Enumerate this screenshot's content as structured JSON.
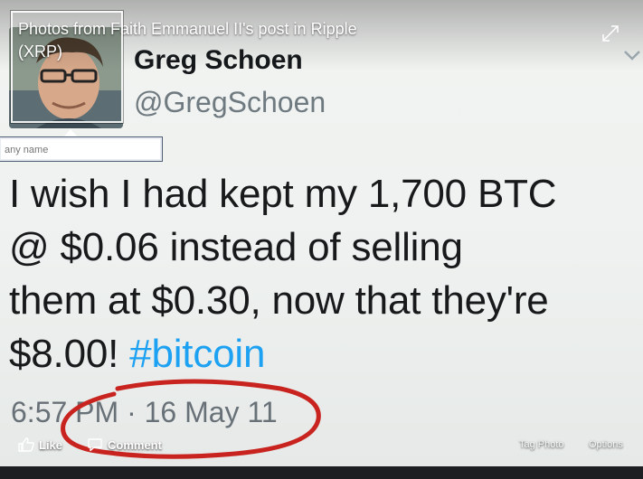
{
  "viewer": {
    "title": "Photos from Faith Emmanuel II's post in Ripple (XRP)",
    "expand_icon": "expand-icon",
    "options_chevron_icon": "chevron-down-icon"
  },
  "tag": {
    "placeholder": "any name",
    "value": ""
  },
  "tweet": {
    "display_name": "Greg Schoen",
    "handle": "@GregSchoen",
    "text_line1": "I wish I had kept my 1,700 BTC",
    "text_line2": "@ $0.06 instead of selling",
    "text_line3": "them at $0.30, now that they're",
    "text_line4_prefix": "$8.00! ",
    "hashtag": "#bitcoin",
    "timestamp": "6:57 PM · 16 May 11",
    "hashtag_color": "#1da1f2",
    "annotation_color": "#c8231e"
  },
  "actions": {
    "like_label": "Like",
    "comment_label": "Comment",
    "tag_photo_label": "Tag Photo",
    "options_label": "Options",
    "like_icon": "thumbs-up-icon",
    "comment_icon": "speech-bubble-icon"
  }
}
